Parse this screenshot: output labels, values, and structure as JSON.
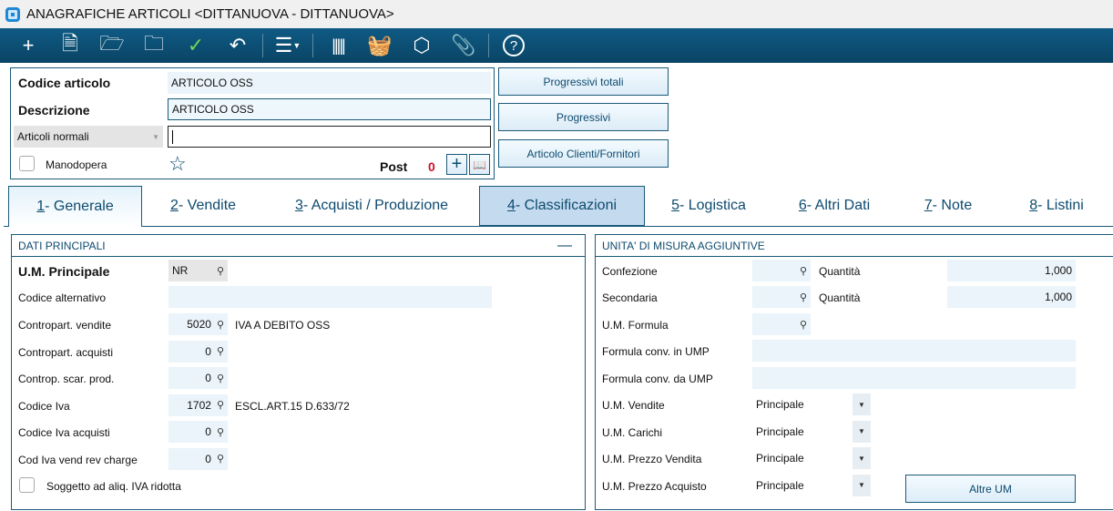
{
  "window": {
    "title": "ANAGRAFICHE ARTICOLI <DITTANUOVA - DITTANUOVA>"
  },
  "toolbar": [
    "plus-icon",
    "document-icon",
    "folder-open-icon",
    "folder-clock-icon",
    "check-icon",
    "undo-icon",
    "menu-icon",
    "barcode-icon",
    "basket-icon",
    "box-icon",
    "paperclip-icon",
    "help-icon"
  ],
  "header": {
    "codice_label": "Codice articolo",
    "codice_value": "ARTICOLO OSS",
    "descrizione_label": "Descrizione",
    "descrizione_value": "ARTICOLO OSS",
    "tipo_select": "Articoli normali",
    "extra_value": "",
    "manodopera_label": "Manodopera",
    "post_label": "Post",
    "post_count": "0",
    "buttons": [
      "Progressivi totali",
      "Progressivi",
      "Articolo Clienti/Fornitori"
    ]
  },
  "tabs": [
    {
      "num": "1",
      "label": " - Generale"
    },
    {
      "num": "2",
      "label": " - Vendite"
    },
    {
      "num": "3",
      "label": " - Acquisti / Produzione"
    },
    {
      "num": "4",
      "label": " - Classificazioni"
    },
    {
      "num": "5",
      "label": " - Logistica"
    },
    {
      "num": "6",
      "label": " - Altri Dati"
    },
    {
      "num": "7",
      "label": " - Note"
    },
    {
      "num": "8",
      "label": " - Listini"
    }
  ],
  "dati": {
    "title": "DATI PRINCIPALI",
    "um_label": "U.M. Principale",
    "um_value": "NR",
    "cod_alt_label": "Codice alternativo",
    "rows": [
      {
        "label": "Contropart. vendite",
        "value": "5020",
        "desc": "IVA A DEBITO OSS"
      },
      {
        "label": "Contropart. acquisti",
        "value": "0",
        "desc": ""
      },
      {
        "label": "Controp. scar. prod.",
        "value": "0",
        "desc": ""
      },
      {
        "label": "Codice Iva",
        "value": "1702",
        "desc": "ESCL.ART.15 D.633/72"
      },
      {
        "label": "Codice Iva acquisti",
        "value": "0",
        "desc": ""
      },
      {
        "label": "Cod Iva vend rev charge",
        "value": "0",
        "desc": ""
      }
    ],
    "soggetto_label": "Soggetto ad aliq. IVA ridotta"
  },
  "um": {
    "title": "UNITA' DI MISURA AGGIUNTIVE",
    "confezione": "Confezione",
    "secondaria": "Secondaria",
    "quantita": "Quantità",
    "q1": "1,000",
    "q2": "1,000",
    "formula": "U.M. Formula",
    "conv_in": "Formula conv. in UMP",
    "conv_da": "Formula conv. da UMP",
    "selects": [
      {
        "label": "U.M. Vendite",
        "value": "Principale"
      },
      {
        "label": "U.M. Carichi",
        "value": "Principale"
      },
      {
        "label": "U.M. Prezzo Vendita",
        "value": "Principale"
      },
      {
        "label": "U.M. Prezzo Acquisto",
        "value": "Principale"
      }
    ],
    "altre_button": "Altre UM"
  }
}
